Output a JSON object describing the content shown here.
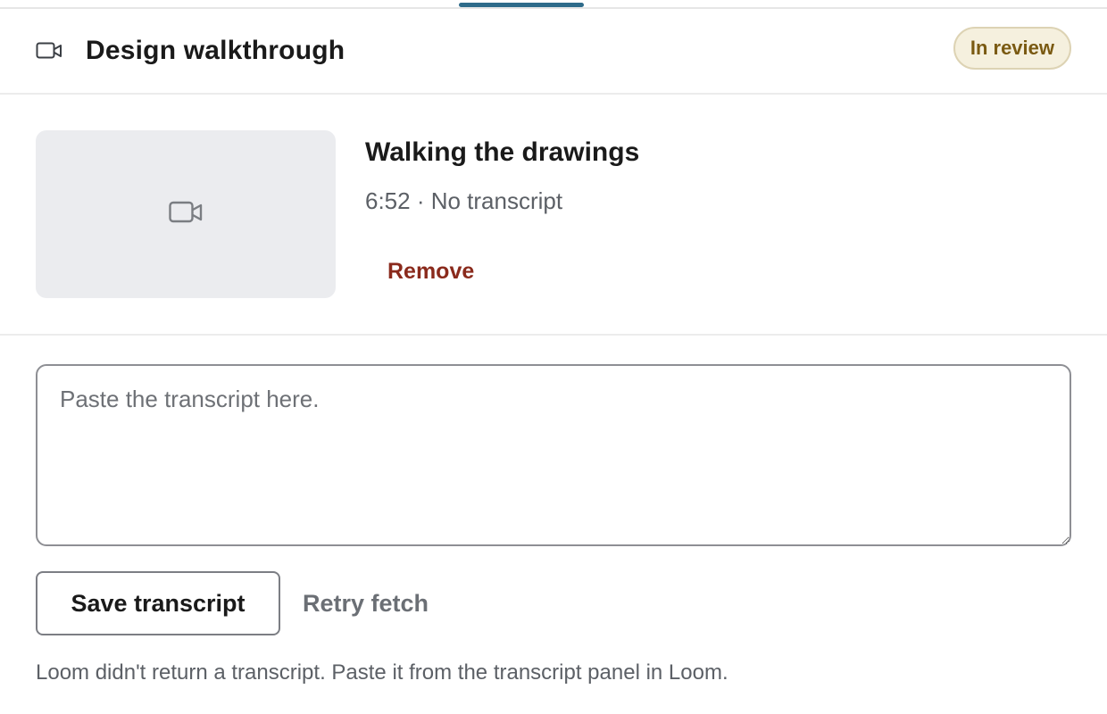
{
  "header": {
    "title": "Design walkthrough",
    "status_badge": "In review",
    "icon": "video-camera-icon"
  },
  "video": {
    "title": "Walking the drawings",
    "meta": "6:52 · No transcript",
    "thumbnail_icon": "video-camera-icon",
    "remove_label": "Remove"
  },
  "transcript": {
    "value": "",
    "placeholder": "Paste the transcript here."
  },
  "actions": {
    "save_label": "Save transcript",
    "retry_label": "Retry fetch"
  },
  "help_text": "Loom didn't return a transcript. Paste it from the transcript panel in Loom.",
  "colors": {
    "accent": "#2e6b8a",
    "badge_bg": "#f5f0de",
    "badge_text": "#7a5a12",
    "danger": "#8a2a1c"
  }
}
